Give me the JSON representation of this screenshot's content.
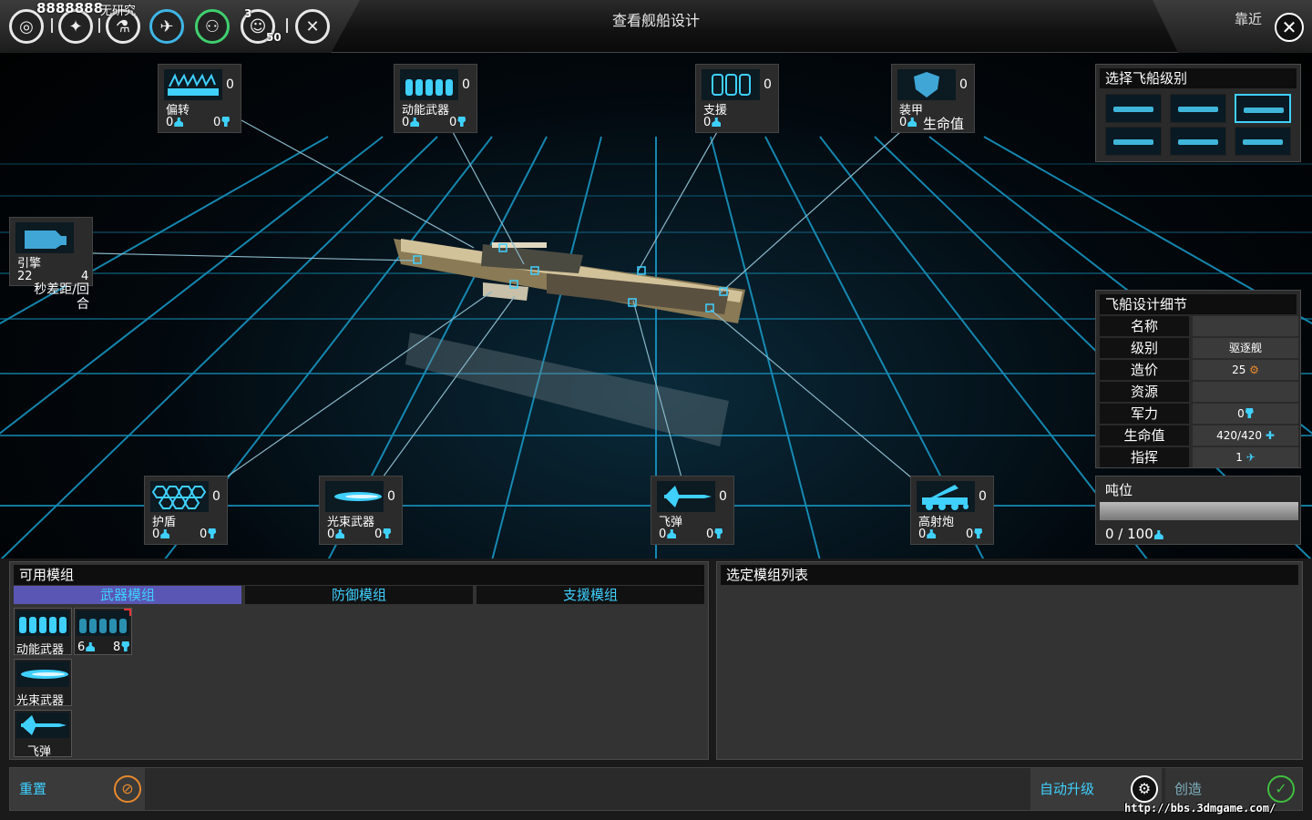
{
  "topbar": {
    "counter": "8888888",
    "research_label": "无研究",
    "badge_3": "3",
    "badge_50": "50",
    "title": "查看舰船设计",
    "zoom": "靠近",
    "close": "✕"
  },
  "slots": {
    "deflector": {
      "name": "偏转",
      "count": "0",
      "a": "0",
      "b": "0"
    },
    "kinetic": {
      "name": "动能武器",
      "count": "0",
      "a": "0",
      "b": "0"
    },
    "support": {
      "name": "支援",
      "count": "0",
      "a": "0"
    },
    "armor": {
      "name": "装甲",
      "count": "0",
      "a": "0",
      "c": "生命值"
    },
    "engine": {
      "name": "引擎",
      "a": "22",
      "b": "4",
      "c": "秒差距/回合"
    },
    "shield": {
      "name": "护盾",
      "count": "0",
      "a": "0",
      "b": "0"
    },
    "beam": {
      "name": "光束武器",
      "count": "0",
      "a": "0",
      "b": "0"
    },
    "missile": {
      "name": "飞弹",
      "count": "0",
      "a": "0",
      "b": "0"
    },
    "flak": {
      "name": "高射炮",
      "count": "0",
      "a": "0",
      "b": "0"
    }
  },
  "class_panel": {
    "title": "选择飞船级别"
  },
  "details": {
    "title": "飞船设计细节",
    "rows": [
      {
        "label": "名称",
        "value": ""
      },
      {
        "label": "级别",
        "value": "驱逐舰"
      },
      {
        "label": "造价",
        "value": "25"
      },
      {
        "label": "资源",
        "value": ""
      },
      {
        "label": "军力",
        "value": "0"
      },
      {
        "label": "生命值",
        "value": "420/420"
      },
      {
        "label": "指挥",
        "value": "1"
      }
    ]
  },
  "tonnage": {
    "title": "吨位",
    "value": "0 / 100",
    "fill": 0
  },
  "available": {
    "title": "可用模组",
    "tabs": [
      "武器模组",
      "防御模组",
      "支援模组"
    ],
    "modules": [
      {
        "name": "动能武器"
      },
      {
        "a": "6",
        "b": "8"
      },
      {
        "name": "光束武器"
      },
      {
        "name": "飞弹"
      }
    ]
  },
  "selected": {
    "title": "选定模组列表"
  },
  "actions": {
    "reset": "重置",
    "auto": "自动升级",
    "create": "创造"
  },
  "watermark": "http://bbs.3dmgame.com/",
  "colors": {
    "accent": "#3fd0ff",
    "tab_active": "#5a56b4",
    "reset_icon": "#e8892b",
    "create_icon": "#3fbf3f"
  }
}
